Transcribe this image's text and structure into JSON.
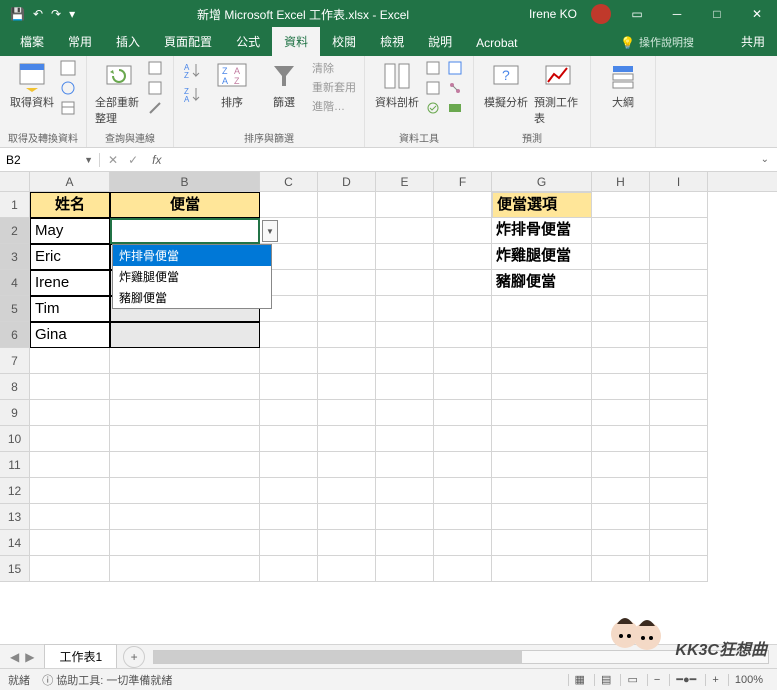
{
  "titlebar": {
    "title": "新增 Microsoft Excel 工作表.xlsx - Excel",
    "user": "Irene KO"
  },
  "tabs": {
    "file": "檔案",
    "home": "常用",
    "insert": "插入",
    "layout": "頁面配置",
    "formulas": "公式",
    "data": "資料",
    "review": "校閱",
    "view": "檢視",
    "help": "說明",
    "acrobat": "Acrobat",
    "tellme_placeholder": "操作說明搜",
    "share": "共用"
  },
  "ribbon": {
    "getdata": "取得資料",
    "getdata_group": "取得及轉換資料",
    "refresh": "全部重新整理",
    "queries_group": "查詢與連線",
    "sort": "排序",
    "filter": "篩選",
    "clear": "清除",
    "reapply": "重新套用",
    "advanced": "進階…",
    "sortfilter_group": "排序與篩選",
    "texttools": "資料剖析",
    "datatools_group": "資料工具",
    "whatif": "模擬分析",
    "forecast": "預測工作表",
    "forecast_group": "預測",
    "outline": "大綱"
  },
  "namebox": "B2",
  "formula": "",
  "columns": [
    "A",
    "B",
    "C",
    "D",
    "E",
    "F",
    "G",
    "H",
    "I"
  ],
  "rows": [
    "1",
    "2",
    "3",
    "4",
    "5",
    "6",
    "7",
    "8",
    "9",
    "10",
    "11",
    "12",
    "13",
    "14",
    "15"
  ],
  "cells": {
    "A1": "姓名",
    "B1": "便當",
    "A2": "May",
    "A3": "Eric",
    "A4": "Irene",
    "A5": "Tim",
    "A6": "Gina",
    "G1": "便當選項",
    "G2": "炸排骨便當",
    "G3": "炸雞腿便當",
    "G4": "豬腳便當"
  },
  "dropdown": {
    "opt1": "炸排骨便當",
    "opt2": "炸雞腿便當",
    "opt3": "豬腳便當"
  },
  "sheet_tab": "工作表1",
  "statusbar": {
    "ready": "就緒",
    "accessibility": "協助工具: 一切準備就緒",
    "zoom": "100%"
  },
  "watermark": "KK3C狂想曲"
}
